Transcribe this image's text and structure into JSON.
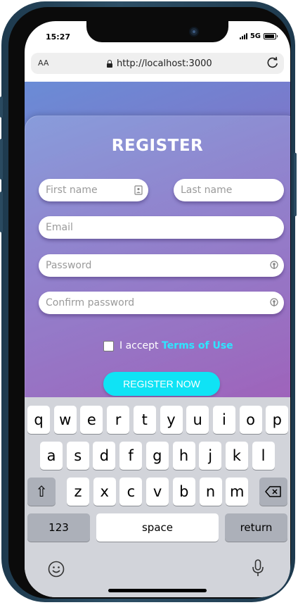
{
  "status_bar": {
    "time": "15:27",
    "network": "5G"
  },
  "browser": {
    "text_size_label": "AA",
    "url": "http://localhost:3000"
  },
  "form": {
    "title": "REGISTER",
    "first_name_placeholder": "First name",
    "last_name_placeholder": "Last name",
    "email_placeholder": "Email",
    "password_placeholder": "Password",
    "confirm_password_placeholder": "Confirm password",
    "terms_prefix": "I accept",
    "terms_link": "Terms of Use",
    "submit_label": "REGISTER NOW"
  },
  "keyboard": {
    "row1": [
      "q",
      "w",
      "e",
      "r",
      "t",
      "y",
      "u",
      "i",
      "o",
      "p"
    ],
    "row2": [
      "a",
      "s",
      "d",
      "f",
      "g",
      "h",
      "j",
      "k",
      "l"
    ],
    "row3": [
      "z",
      "x",
      "c",
      "v",
      "b",
      "n",
      "m"
    ],
    "shift": "⇧",
    "numbers_label": "123",
    "space_label": "space",
    "return_label": "return"
  },
  "colors": {
    "accent_button": "#0fe3f5",
    "terms_link": "#2ee6ff",
    "gradient_start": "#6a8cd6",
    "gradient_end": "#9a5cb8"
  }
}
